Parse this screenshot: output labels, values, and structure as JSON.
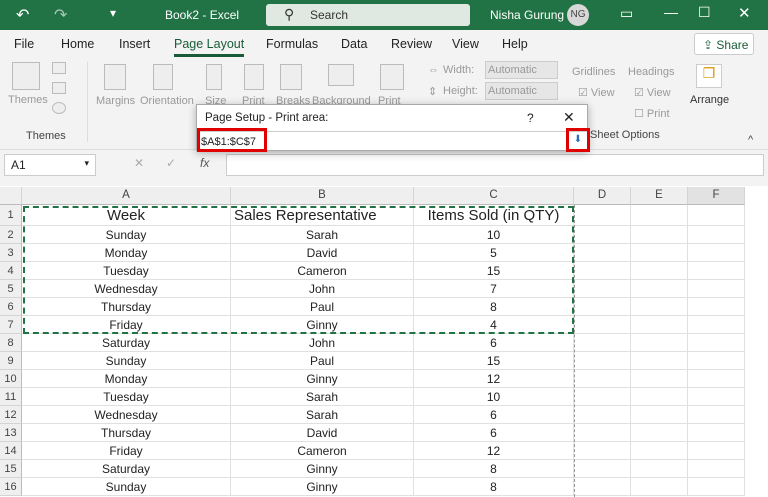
{
  "title": "Book2 - Excel",
  "search_placeholder": "Search",
  "user": {
    "name": "Nisha Gurung",
    "initials": "NG"
  },
  "share": "Share",
  "tabs": [
    "File",
    "Home",
    "Insert",
    "Page Layout",
    "Formulas",
    "Data",
    "Review",
    "View",
    "Help"
  ],
  "active_tab": "Page Layout",
  "ribbon": {
    "themes": "Themes",
    "themes_group": "Themes",
    "margins": "Margins",
    "orientation": "Orientation",
    "size": "Size",
    "print_area": "Print",
    "breaks": "Breaks",
    "background": "Background",
    "print_titles": "Print",
    "width_label": "Width:",
    "height_label": "Height:",
    "width_value": "Automatic",
    "height_value": "Automatic",
    "gridlines": "Gridlines",
    "headings": "Headings",
    "view": "View",
    "print": "Print",
    "sheet_options": "Sheet Options",
    "arrange": "Arrange"
  },
  "name_box": "A1",
  "dialog": {
    "title": "Page Setup - Print area:",
    "help": "?",
    "value": "$A$1:$C$7"
  },
  "columns": [
    "A",
    "B",
    "C",
    "D",
    "E",
    "F"
  ],
  "header_row": [
    "Week",
    "Sales Representative",
    "Items Sold (in QTY)"
  ],
  "rows": [
    [
      "Sunday",
      "Sarah",
      "10"
    ],
    [
      "Monday",
      "David",
      "5"
    ],
    [
      "Tuesday",
      "Cameron",
      "15"
    ],
    [
      "Wednesday",
      "John",
      "7"
    ],
    [
      "Thursday",
      "Paul",
      "8"
    ],
    [
      "Friday",
      "Ginny",
      "4"
    ],
    [
      "Saturday",
      "John",
      "6"
    ],
    [
      "Sunday",
      "Paul",
      "15"
    ],
    [
      "Monday",
      "Ginny",
      "12"
    ],
    [
      "Tuesday",
      "Sarah",
      "10"
    ],
    [
      "Wednesday",
      "Sarah",
      "6"
    ],
    [
      "Thursday",
      "David",
      "6"
    ],
    [
      "Friday",
      "Cameron",
      "12"
    ],
    [
      "Saturday",
      "Ginny",
      "8"
    ],
    [
      "Sunday",
      "Ginny",
      "8"
    ]
  ],
  "colors": {
    "excel_green": "#217346",
    "highlight": "#e00000",
    "selection_border": "#217346"
  }
}
